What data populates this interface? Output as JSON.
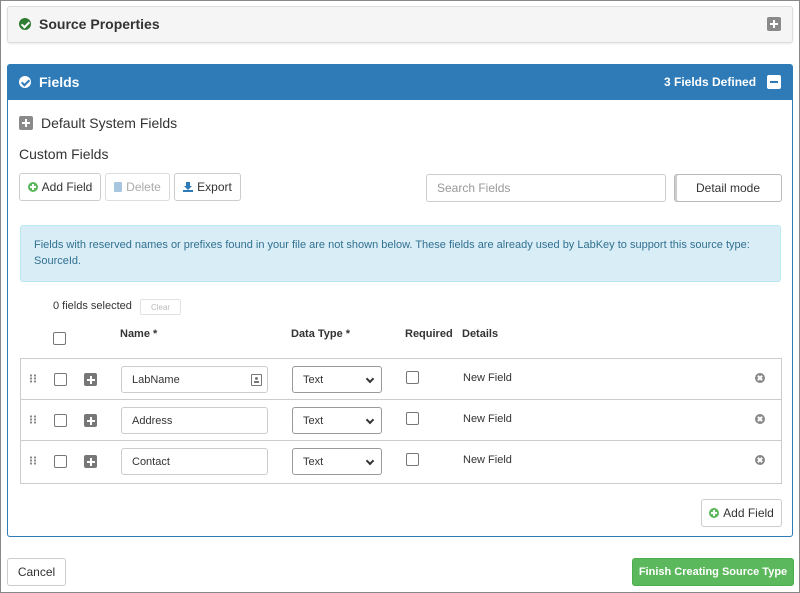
{
  "source_properties": {
    "title": "Source Properties"
  },
  "fields_panel": {
    "title": "Fields",
    "count_label": "3 Fields Defined",
    "default_system_fields": "Default System Fields",
    "custom_fields": "Custom Fields",
    "toolbar": {
      "add_field": "Add Field",
      "delete": "Delete",
      "export": "Export",
      "search_placeholder": "Search Fields",
      "detail_mode": "Detail mode"
    },
    "alert": "Fields with reserved names or prefixes found in your file are not shown below. These fields are already used by LabKey to support this source type: SourceId.",
    "selection": {
      "count_label": "0 fields selected",
      "clear": "Clear"
    },
    "columns": {
      "name": "Name *",
      "data_type": "Data Type *",
      "required": "Required",
      "details": "Details"
    },
    "rows": [
      {
        "name": "LabName",
        "type": "Text",
        "details": "New Field"
      },
      {
        "name": "Address",
        "type": "Text",
        "details": "New Field"
      },
      {
        "name": "Contact",
        "type": "Text",
        "details": "New Field"
      }
    ],
    "add_field_bottom": "Add Field"
  },
  "footer": {
    "cancel": "Cancel",
    "finish": "Finish Creating Source Type"
  },
  "colors": {
    "header_blue": "#2e7bb8",
    "success_green": "#5cb85c",
    "alert_bg": "#d9edf7"
  }
}
